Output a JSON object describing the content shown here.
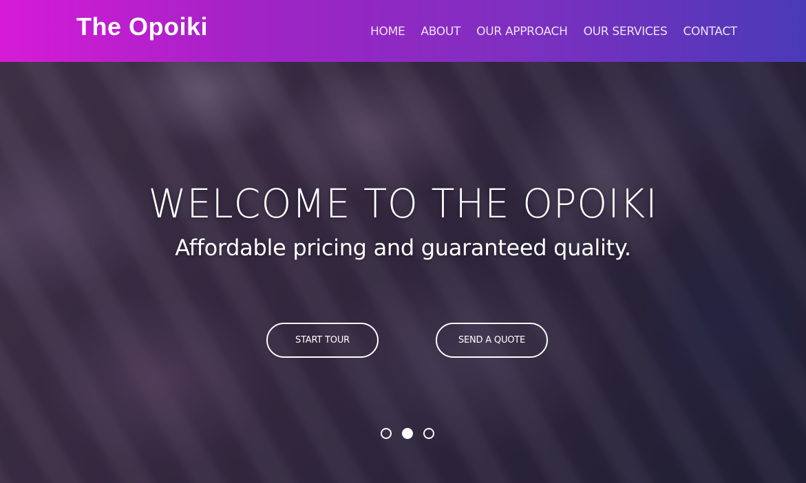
{
  "header": {
    "brand": "The Opoiki",
    "nav": [
      {
        "label": "HOME"
      },
      {
        "label": "ABOUT"
      },
      {
        "label": "OUR APPROACH"
      },
      {
        "label": "OUR SERVICES"
      },
      {
        "label": "CONTACT"
      }
    ]
  },
  "hero": {
    "title": "WELCOME TO THE OPOIKI",
    "subtitle": "Affordable pricing and guaranteed quality.",
    "buttons": {
      "start_tour": "START TOUR",
      "send_quote": "SEND A QUOTE"
    },
    "carousel": {
      "slide_count": 3,
      "active_index": 1
    }
  },
  "colors": {
    "header_gradient_start": "#d61bd6",
    "header_gradient_end": "#4a3ab8",
    "text": "#ffffff"
  }
}
